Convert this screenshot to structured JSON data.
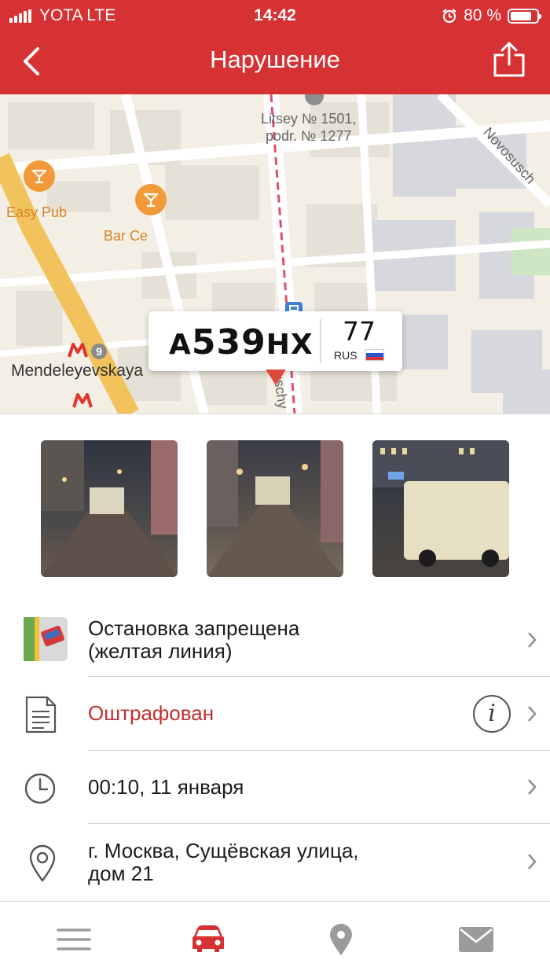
{
  "status_bar": {
    "carrier": "YOTA LTE",
    "time": "14:42",
    "battery": "80 %",
    "battery_level": 0.8
  },
  "header": {
    "title": "Нарушение",
    "back_icon": "chevron-left-icon",
    "share_icon": "share-icon"
  },
  "map": {
    "labels": {
      "school": "Litsey № 1501,\npodr. № 1277",
      "street_ne": "Novosusch",
      "street_main": "Suschy",
      "metro_station": "Mendeleyevskaya",
      "metro_line": "9"
    },
    "pois": [
      {
        "name": "Easy Pub",
        "icon": "cocktail-icon"
      },
      {
        "name": "Bar Ce",
        "icon": "cocktail-icon"
      }
    ],
    "plate": {
      "letter1": "А",
      "digits": "539",
      "letters": "НХ",
      "region": "77",
      "country": "RUS"
    }
  },
  "photos": [
    {
      "alt": "photo-1"
    },
    {
      "alt": "photo-2"
    },
    {
      "alt": "photo-3"
    }
  ],
  "details": {
    "violation": "Остановка запрещена\n(желтая линия)",
    "status": "Оштрафован",
    "datetime": "00:10, 11 января",
    "address": "г. Москва, Сущёвская улица,\nдом 21"
  },
  "tabs": [
    {
      "name": "menu",
      "icon": "menu-icon",
      "active": false
    },
    {
      "name": "car",
      "icon": "car-icon",
      "active": true
    },
    {
      "name": "location",
      "icon": "location-pin-icon",
      "active": false
    },
    {
      "name": "mail",
      "icon": "mail-icon",
      "active": false
    }
  ],
  "colors": {
    "brand": "#d63133",
    "status_red": "#c62f2f",
    "tab_inactive": "#9b9b9b"
  }
}
